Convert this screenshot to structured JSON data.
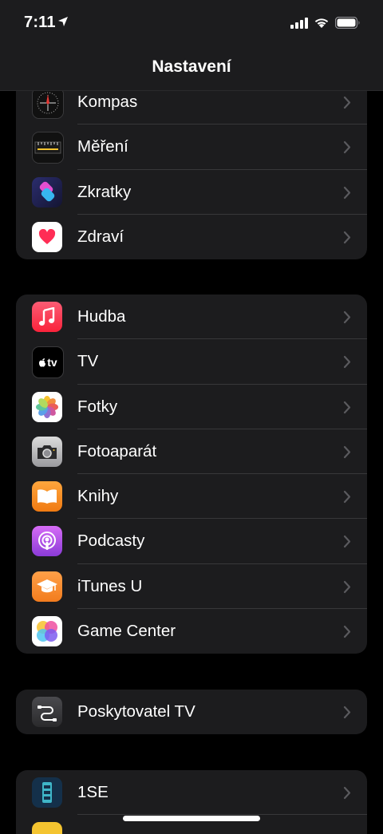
{
  "status": {
    "time": "7:11"
  },
  "nav": {
    "title": "Nastavení"
  },
  "groups": {
    "g1": [
      {
        "label": "Kompas",
        "icon": "compass-icon"
      },
      {
        "label": "Měření",
        "icon": "measure-icon"
      },
      {
        "label": "Zkratky",
        "icon": "shortcuts-icon"
      },
      {
        "label": "Zdraví",
        "icon": "health-icon"
      }
    ],
    "g2": [
      {
        "label": "Hudba",
        "icon": "music-icon"
      },
      {
        "label": "TV",
        "icon": "tv-icon",
        "icon_text": "tv"
      },
      {
        "label": "Fotky",
        "icon": "photos-icon"
      },
      {
        "label": "Fotoaparát",
        "icon": "camera-icon"
      },
      {
        "label": "Knihy",
        "icon": "books-icon"
      },
      {
        "label": "Podcasty",
        "icon": "podcasts-icon"
      },
      {
        "label": "iTunes U",
        "icon": "itunes-u-icon"
      },
      {
        "label": "Game Center",
        "icon": "game-center-icon"
      }
    ],
    "g3": [
      {
        "label": "Poskytovatel TV",
        "icon": "tv-provider-icon"
      }
    ],
    "g4": [
      {
        "label": "1SE",
        "icon": "1se-icon"
      }
    ]
  },
  "colors": {
    "background": "#000000",
    "cell": "#1c1c1e",
    "separator": "#38383a",
    "chevron": "#5a5a5e"
  }
}
